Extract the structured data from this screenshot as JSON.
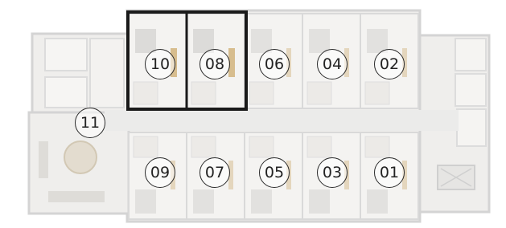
{
  "plan": {
    "unit_markers": [
      {
        "id": "10",
        "label": "10",
        "highlighted": true
      },
      {
        "id": "08",
        "label": "08",
        "highlighted": true
      },
      {
        "id": "06",
        "label": "06",
        "highlighted": false
      },
      {
        "id": "04",
        "label": "04",
        "highlighted": false
      },
      {
        "id": "02",
        "label": "02",
        "highlighted": false
      },
      {
        "id": "09",
        "label": "09",
        "highlighted": false
      },
      {
        "id": "07",
        "label": "07",
        "highlighted": false
      },
      {
        "id": "05",
        "label": "05",
        "highlighted": false
      },
      {
        "id": "03",
        "label": "03",
        "highlighted": false
      },
      {
        "id": "01",
        "label": "01",
        "highlighted": false
      },
      {
        "id": "11",
        "label": "11",
        "highlighted": false
      }
    ],
    "colors": {
      "wall": "#d8d8d8",
      "floor": "#f2f1ef",
      "corridor": "#ecebea",
      "highlight_frame": "#1a1a1a",
      "wood": "#c9a46a",
      "bed": "#b6b6b6"
    }
  }
}
